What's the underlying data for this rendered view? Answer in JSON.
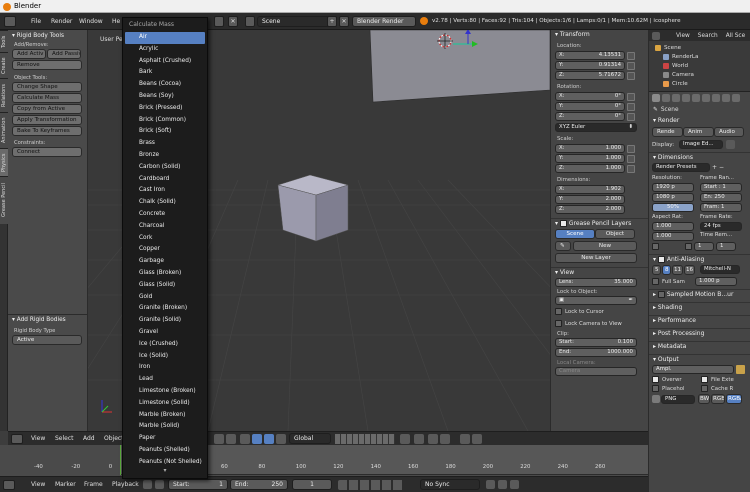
{
  "window": {
    "title": "Blender"
  },
  "menubar": {
    "items": [
      "File",
      "Render",
      "Window",
      "He"
    ],
    "scene": "Scene",
    "engine": "Blender Render",
    "stats": "v2.78 | Verts:80 | Faces:92 | Tris:104 | Objects:1/6 | Lamps:0/1 | Mem:10.62M | icosphere"
  },
  "toolpanel": {
    "header": "Rigid Body Tools",
    "tabs": [
      "Tools",
      "Create",
      "Relations",
      "Animation",
      "Physics",
      "Grease Pencil"
    ],
    "add_remove_label": "Add/Remove:",
    "add_active": "Add Activ",
    "add_passive": "Add Passiv",
    "remove": "Remove",
    "object_tools_label": "Object Tools:",
    "buttons": [
      "Change Shape",
      "Calculate Mass",
      "Copy from Active",
      "Apply Transformation",
      "Bake To Keyframes"
    ],
    "constraints_label": "Constraints:",
    "connect": "Connect",
    "add_rigid_header": "Add Rigid Bodies",
    "rigid_type_label": "Rigid Body Type",
    "rigid_type_value": "Active"
  },
  "viewport": {
    "label": "User Pers"
  },
  "dropdown": {
    "title": "Calculate Mass",
    "items": [
      "Air",
      "Acrylic",
      "Asphalt (Crushed)",
      "Bark",
      "Beans (Cocoa)",
      "Beans (Soy)",
      "Brick (Pressed)",
      "Brick (Common)",
      "Brick (Soft)",
      "Brass",
      "Bronze",
      "Carbon (Solid)",
      "Cardboard",
      "Cast Iron",
      "Chalk (Solid)",
      "Concrete",
      "Charcoal",
      "Cork",
      "Copper",
      "Garbage",
      "Glass (Broken)",
      "Glass (Solid)",
      "Gold",
      "Granite (Broken)",
      "Granite (Solid)",
      "Gravel",
      "Ice (Crushed)",
      "Ice (Solid)",
      "Iron",
      "Lead",
      "Limestone (Broken)",
      "Limestone (Solid)",
      "Marble (Broken)",
      "Marble (Solid)",
      "Paper",
      "Peanuts (Shelled)",
      "Peanuts (Not Shelled)"
    ],
    "selected": "Air"
  },
  "npanel": {
    "transform": "Transform",
    "location_label": "Location:",
    "location": [
      {
        "axis": "X:",
        "value": "4.13531"
      },
      {
        "axis": "Y:",
        "value": "0.91314"
      },
      {
        "axis": "Z:",
        "value": "5.71672"
      }
    ],
    "rotation_label": "Rotation:",
    "rotation": [
      {
        "axis": "X:",
        "value": "0°"
      },
      {
        "axis": "Y:",
        "value": "0°"
      },
      {
        "axis": "Z:",
        "value": "0°"
      }
    ],
    "rotation_mode": "XYZ Euler",
    "scale_label": "Scale:",
    "scale": [
      {
        "axis": "X:",
        "value": "1.000"
      },
      {
        "axis": "Y:",
        "value": "1.000"
      },
      {
        "axis": "Z:",
        "value": "1.000"
      }
    ],
    "dimensions_label": "Dimensions:",
    "dimensions": [
      {
        "axis": "X:",
        "value": "1.902"
      },
      {
        "axis": "Y:",
        "value": "2.000"
      },
      {
        "axis": "Z:",
        "value": "2.000"
      }
    ],
    "grease_pencil": "Grease Pencil Layers",
    "gp_scene": "Scene",
    "gp_object": "Object",
    "gp_new": "New",
    "gp_new_layer": "New Layer",
    "view": "View",
    "lens_label": "Lens:",
    "lens_value": "35.000",
    "lock_object_label": "Lock to Object:",
    "lock_cursor": "Lock to Cursor",
    "lock_camera": "Lock Camera to View",
    "clip_label": "Clip:",
    "clip_start_label": "Start:",
    "clip_start": "0.100",
    "clip_end_label": "End:",
    "clip_end": "1000.000",
    "local_camera_label": "Local Camera:",
    "local_camera": "Camera"
  },
  "outliner": {
    "header_view": "View",
    "header_search": "Search",
    "header_all": "All Sce",
    "items": [
      "Scene",
      "RenderLa",
      "World",
      "Camera",
      "Circle"
    ]
  },
  "properties": {
    "scene": "Scene",
    "render": "Render",
    "render_btn": "Rende",
    "anim_btn": "Anim",
    "audio_btn": "Audio",
    "display_label": "Display:",
    "display_value": "Image Ed...",
    "dimensions": "Dimensions",
    "render_presets": "Render Presets",
    "resolution_label": "Resolution:",
    "res_x": "1920 p",
    "res_y": "1080 p",
    "res_pct": "50%",
    "frame_range_label": "Frame Ran...",
    "start": "Start : 1",
    "end": "En: 250",
    "frame_step": "Fram: 1",
    "aspect_label": "Aspect Rat:",
    "aspect_x": "1.000",
    "aspect_y": "1.000",
    "frame_rate_label": "Frame Rate:",
    "fps": "24 fps",
    "time_rem_label": "Time Rem...",
    "time_rem_a": "1",
    "time_rem_b": "1",
    "anti_aliasing": "Anti-Aliasing",
    "aa_samples": [
      "5",
      "8",
      "11",
      "16"
    ],
    "aa_filter": "Mitchell-N",
    "full_sample": "Full Sam",
    "aa_size": "1.000 p",
    "sampled_motion": "Sampled Motion B...ur",
    "shading": "Shading",
    "performance": "Performance",
    "post_processing": "Post Processing",
    "metadata": "Metadata",
    "output": "Output",
    "output_path": "Ampl.",
    "overwrite": "Overwr",
    "file_ext": "File Exte",
    "placeholders": "Placehol",
    "cache": "Cache R",
    "format": "PNG",
    "color_bw": "BW",
    "color_rgb": "RGB",
    "color_rgba": "RGBA"
  },
  "viewport_header": {
    "items": [
      "View",
      "Select",
      "Add",
      "Object"
    ],
    "orientation": "Global"
  },
  "timeline": {
    "ticks": [
      "-40",
      "-20",
      "0",
      "20",
      "40",
      "60",
      "80",
      "100",
      "120",
      "140",
      "160",
      "180",
      "200",
      "220",
      "240",
      "260"
    ],
    "menu": [
      "View",
      "Marker",
      "Frame",
      "Playback"
    ],
    "start_label": "Start:",
    "start_value": "1",
    "end_label": "End:",
    "end_value": "250",
    "current": "1",
    "sync": "No Sync"
  }
}
